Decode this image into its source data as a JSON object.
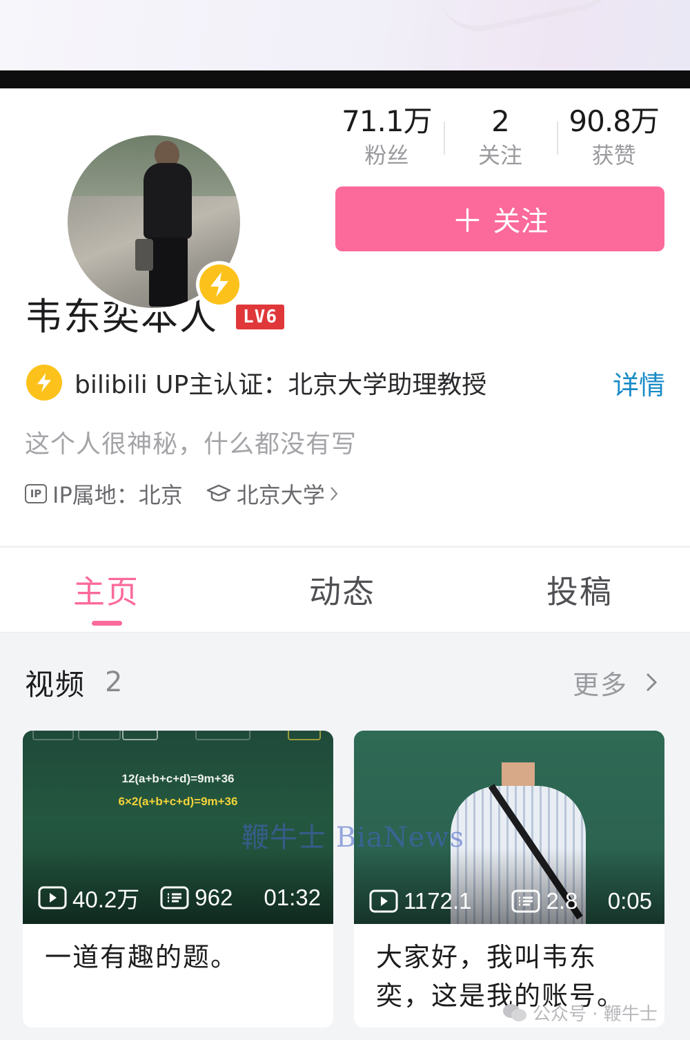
{
  "profile": {
    "name": "韦东奕本人",
    "level_badge": "LV6",
    "stats": [
      {
        "value": "71.1万",
        "label": "粉丝"
      },
      {
        "value": "2",
        "label": "关注"
      },
      {
        "value": "90.8万",
        "label": "获赞"
      }
    ],
    "follow_button": "关注",
    "certification": "bilibili UP主认证：北京大学助理教授",
    "certification_detail": "详情",
    "bio": "这个人很神秘，什么都没有写",
    "ip_label": "IP属地：北京",
    "school": "北京大学"
  },
  "tabs": [
    {
      "label": "主页",
      "active": true
    },
    {
      "label": "动态",
      "active": false
    },
    {
      "label": "投稿",
      "active": false
    }
  ],
  "videos_section": {
    "title": "视频",
    "count": "2",
    "more": "更多"
  },
  "videos": [
    {
      "views": "40.2万",
      "comments": "962",
      "duration": "01:32",
      "title": "一道有趣的题。",
      "thumb_lines": [
        "12(a+b+c+d)=9m+36",
        "6×2(a+b+c+d)=9m+36"
      ]
    },
    {
      "views": "1172.1",
      "comments": "2.8",
      "duration": "0:05",
      "title": "大家好，我叫韦东奕，这是我的账号。"
    }
  ],
  "watermarks": {
    "center": "鞭牛士 BiaNews",
    "bottom": "公众号 · 鞭牛士"
  },
  "colors": {
    "accent_pink": "#fb6a9a",
    "badge_yellow": "#fcc21b",
    "link_blue": "#1a8bc6",
    "level_red": "#e0383a"
  }
}
